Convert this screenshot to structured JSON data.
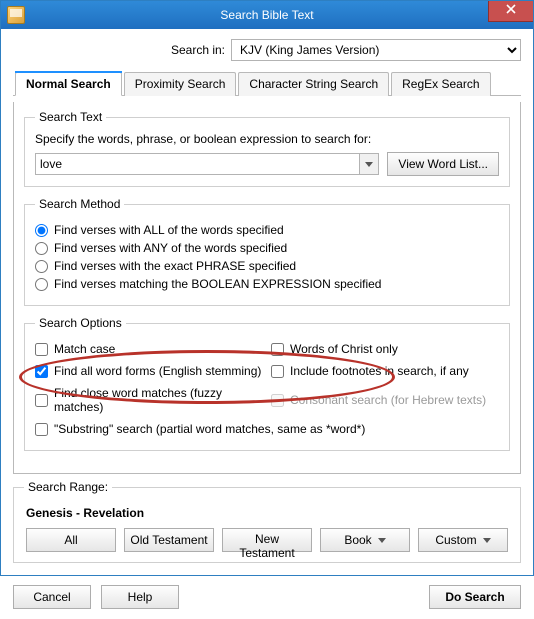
{
  "window": {
    "title": "Search Bible Text"
  },
  "search_in": {
    "label": "Search in:",
    "selected": "KJV (King James Version)"
  },
  "tabs": [
    {
      "label": "Normal Search",
      "active": true
    },
    {
      "label": "Proximity Search",
      "active": false
    },
    {
      "label": "Character String Search",
      "active": false
    },
    {
      "label": "RegEx Search",
      "active": false
    }
  ],
  "search_text": {
    "legend": "Search Text",
    "instruction": "Specify the words, phrase, or boolean expression to search for:",
    "value": "love",
    "wordlist_button": "View Word List..."
  },
  "search_method": {
    "legend": "Search Method",
    "options": [
      "Find verses with ALL of the words specified",
      "Find verses with ANY of the words specified",
      "Find verses with the exact PHRASE specified",
      "Find verses matching the BOOLEAN EXPRESSION specified"
    ],
    "selected": 0
  },
  "search_options": {
    "legend": "Search Options",
    "left": [
      {
        "label": "Match case",
        "checked": false,
        "enabled": true
      },
      {
        "label": "Find all word forms (English stemming)",
        "checked": true,
        "enabled": true
      },
      {
        "label": "Find close word matches (fuzzy matches)",
        "checked": false,
        "enabled": true
      },
      {
        "label": "\"Substring\" search (partial word matches, same as *word*)",
        "checked": false,
        "enabled": true,
        "full": true
      }
    ],
    "right": [
      {
        "label": "Words of Christ only",
        "checked": false,
        "enabled": true
      },
      {
        "label": "Include footnotes in search, if any",
        "checked": false,
        "enabled": true
      },
      {
        "label": "Consonant search (for Hebrew texts)",
        "checked": false,
        "enabled": false
      }
    ]
  },
  "search_range": {
    "legend": "Search Range:",
    "display": "Genesis - Revelation",
    "buttons": [
      "All",
      "Old Testament",
      "New Testament",
      "Book",
      "Custom"
    ],
    "dropdown_flags": [
      false,
      false,
      false,
      true,
      true
    ]
  },
  "footer": {
    "cancel": "Cancel",
    "help": "Help",
    "do_search": "Do Search"
  }
}
